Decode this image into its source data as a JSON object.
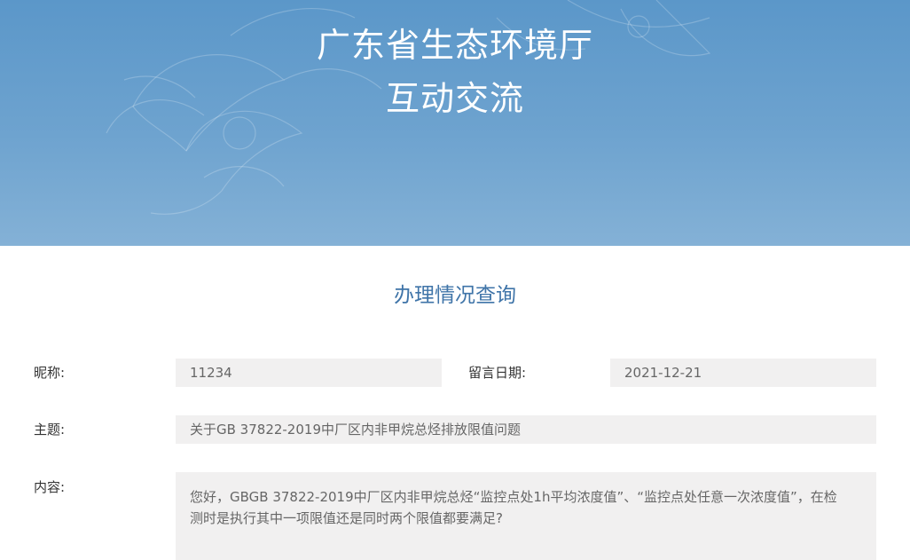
{
  "header": {
    "title_line1": "广东省生态环境厅",
    "title_line2": "互动交流"
  },
  "section": {
    "title": "办理情况查询"
  },
  "form": {
    "nickname_label": "昵称:",
    "nickname_value": "11234",
    "date_label": "留言日期:",
    "date_value": "2021-12-21",
    "subject_label": "主题:",
    "subject_value": "关于GB 37822-2019中厂区内非甲烷总烃排放限值问题",
    "content_label": "内容:",
    "content_value": "您好，GBGB 37822-2019中厂区内非甲烷总烃“监控点处1h平均浓度值”、“监控点处任意一次浓度值”，在检测时是执行其中一项限值还是同时两个限值都要满足?"
  },
  "colors": {
    "banner": "#6aa0cd",
    "section_title": "#3f74a8",
    "field_bg": "#f1f0f0"
  }
}
